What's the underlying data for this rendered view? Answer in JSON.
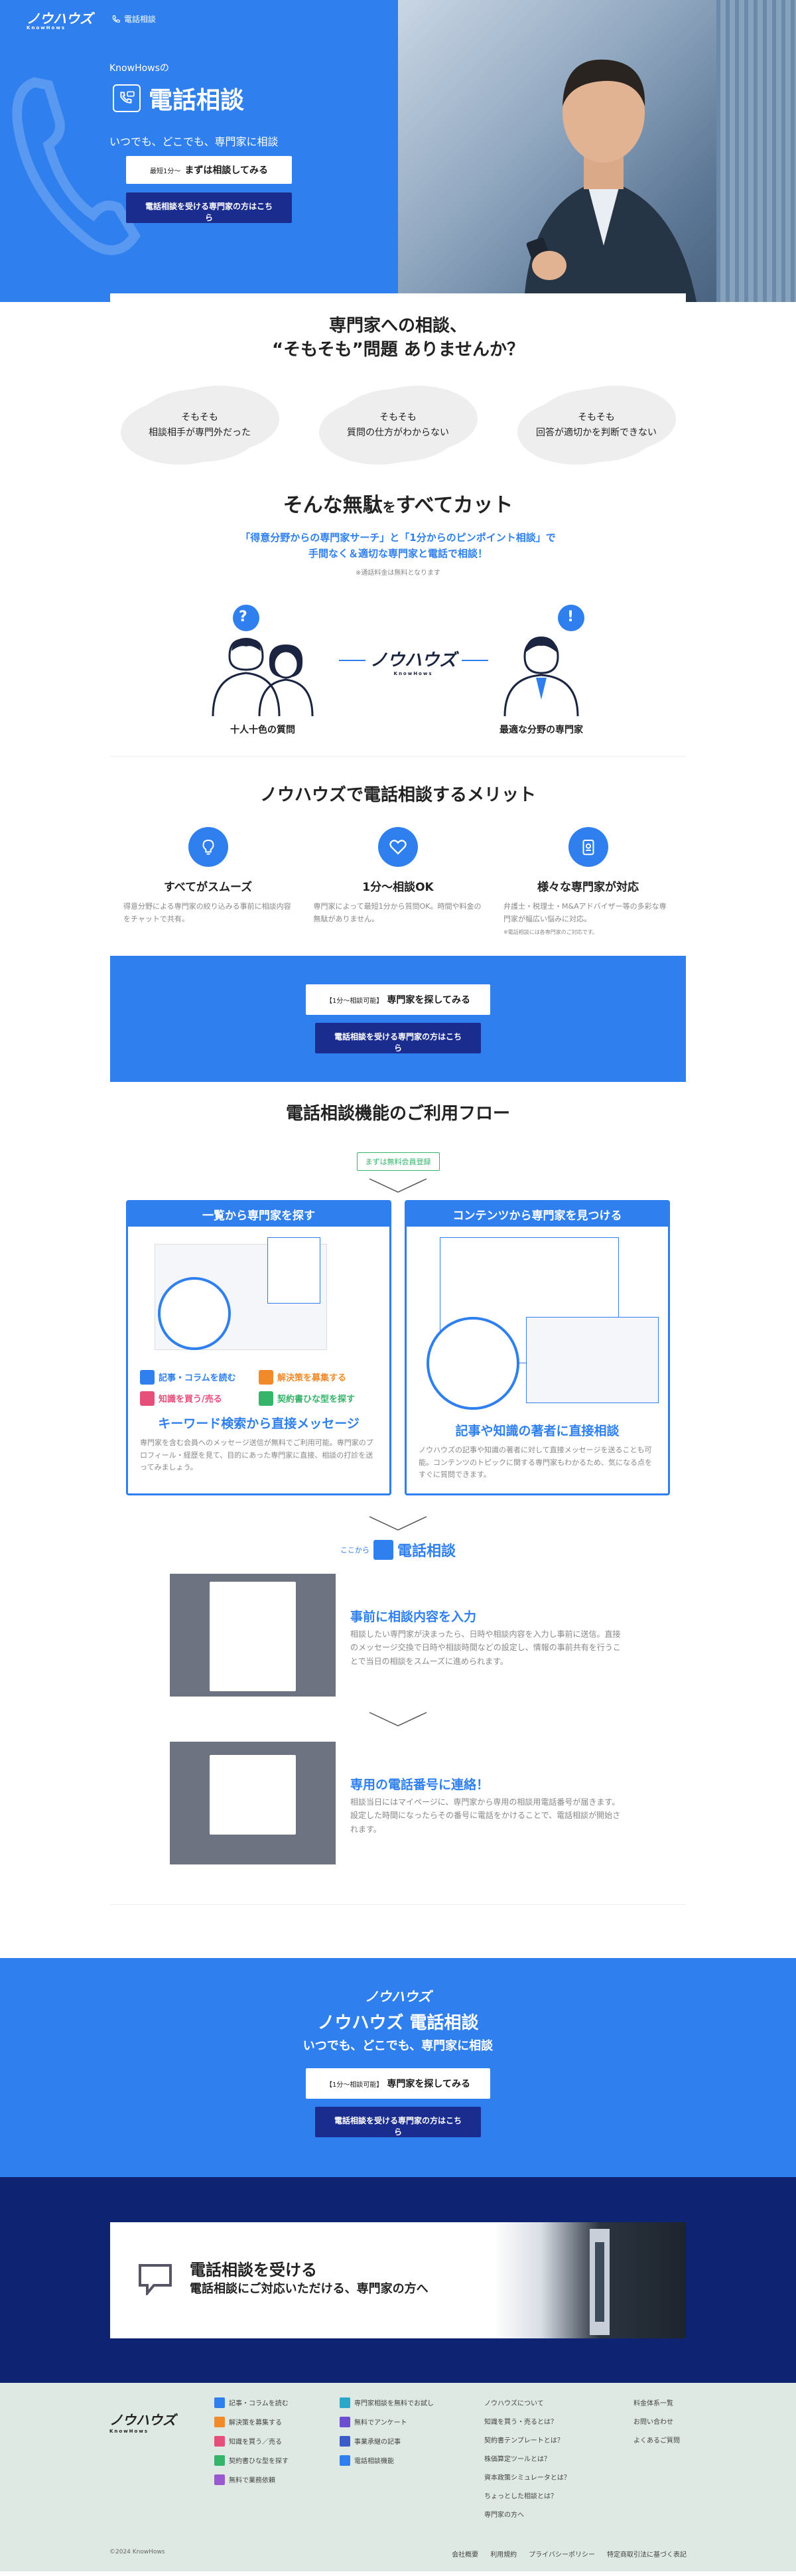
{
  "hero": {
    "logo": "ノウハウズ",
    "logo_sub": "KnowHows",
    "nav_link": "電話相談",
    "brand": "KnowHowsの",
    "title": "電話相談",
    "subtitle": "いつでも、どこでも、専門家に相談",
    "btn_primary_small": "最短1分〜",
    "btn_primary": "まずは相談してみる",
    "btn_secondary": "電話相談を受ける専門家の方はこちら"
  },
  "concerns": {
    "title_line1": "専門家への相談、",
    "title_line2": "“そもそも”問題 ありませんか？",
    "items": [
      {
        "top": "そもそも",
        "bottom": "相談相手が専門外だった"
      },
      {
        "top": "そもそも",
        "bottom": "質問の仕方がわからない"
      },
      {
        "top": "そもそも",
        "bottom": "回答が適切かを判断できない"
      }
    ]
  },
  "cut": {
    "title_a": "そんな無駄",
    "title_b": "を",
    "title_c": "すべてカット",
    "line1": "「得意分野からの専門家サーチ」と「1分からのピンポイント相談」で",
    "line2": "手間なく＆適切な専門家と電話で相談！",
    "note": "※通話料金は無料となります",
    "left_label": "十人十色の質問",
    "right_label": "最適な分野の専門家",
    "center_logo": "ノウハウズ",
    "center_logo_sub": "KnowHows",
    "q_mark": "?",
    "ex_mark": "!"
  },
  "merits": {
    "title": "ノウハウズで電話相談するメリット",
    "items": [
      {
        "title": "すべてがスムーズ",
        "text": "得意分野による専門家の絞り込みる事前に相談内容をチャットで共有。",
        "note": ""
      },
      {
        "title": "1分〜相談OK",
        "text": "専門家によって最短1分から質問OK。時間や料金の無駄がありません。",
        "note": ""
      },
      {
        "title": "様々な専門家が対応",
        "text": "弁護士・税理士・M&Aアドバイザー等の多彩な専門家が幅広い悩みに対応。",
        "note": "※電話相談には各専門家のご対応です。"
      }
    ]
  },
  "cta1": {
    "btn_small": "【1分〜相談可能】",
    "btn": "専門家を探してみる",
    "btn_secondary": "電話相談を受ける専門家の方はこちら"
  },
  "flow": {
    "title": "電話相談機能のご利用フロー",
    "tag": "まずは無料会員登録",
    "box_left": {
      "header": "一覧から専門家を探す",
      "keywords": [
        "記事・コラムを読む",
        "解決策を募集する",
        "知識を買う/売る",
        "契約書ひな型を探す"
      ],
      "title": "キーワード検索から直接メッセージ",
      "text": "専門家を含む会員へのメッセージ送信が無料でご利用可能。専門家のプロフィール・経歴を見て、目的にあった専門家に直接、相談の打診を送ってみましょう。"
    },
    "box_right": {
      "header": "コンテンツから専門家を見つける",
      "title": "記事や知識の著者に直接相談",
      "text": "ノウハウズの記事や知識の著者に対して直接メッセージを送ることも可能。コンテンツのトピックに関する専門家もわかるため、気になる点をすぐに質問できます。"
    },
    "kokokara": "ここから",
    "phone_label": "電話相談",
    "step1": {
      "title": "事前に相談内容を入力",
      "text": "相談したい専門家が決まったら、日時や相談内容を入力し事前に送信。直接のメッセージ交換で日時や相談時間などの設定し、情報の事前共有を行うことで当日の相談をスムーズに進められます。"
    },
    "step2": {
      "title": "専用の電話番号に連絡！",
      "text": "相談当日にはマイページに、専門家から専用の相談用電話番号が届きます。設定した時間になったらその番号に電話をかけることで、電話相談が開始されます。"
    }
  },
  "cta2": {
    "logo": "ノウハウズ",
    "title": "ノウハウズ 電話相談",
    "subtitle": "いつでも、どこでも、専門家に相談",
    "btn_small": "【1分〜相談可能】",
    "btn": "専門家を探してみる",
    "btn_secondary": "電話相談を受ける専門家の方はこちら"
  },
  "expert_banner": {
    "title": "電話相談を受ける",
    "subtitle": "電話相談にご対応いただける、専門家の方へ"
  },
  "footer": {
    "logo": "ノウハウズ",
    "logo_sub": "KnowHows",
    "col1": [
      "記事・コラムを読む",
      "解決策を募集する",
      "知識を買う／売る",
      "契約書ひな型を探す",
      "無料で業務依頼"
    ],
    "col2": [
      "専門家相談を無料でお試し",
      "無料でアンケート",
      "事業承継の記事",
      "電話相談機能"
    ],
    "col3": [
      "ノウハウズについて",
      "知識を買う・売るとは？",
      "契約書テンプレートとは？",
      "株価算定ツールとは？",
      "資本政策シミュレータとは？",
      "ちょっとした相談とは？",
      "専門家の方へ"
    ],
    "col4": [
      "料金体系一覧",
      "お問い合わせ",
      "よくあるご質問"
    ],
    "copyright": "©2024 KnowHows",
    "bottom_links": [
      "会社概要",
      "利用規約",
      "プライバシーポリシー",
      "特定商取引法に基づく表記"
    ]
  },
  "colors": {
    "primary": "#2f80ee",
    "navy": "#1b2c8f",
    "green": "#35b46a"
  }
}
